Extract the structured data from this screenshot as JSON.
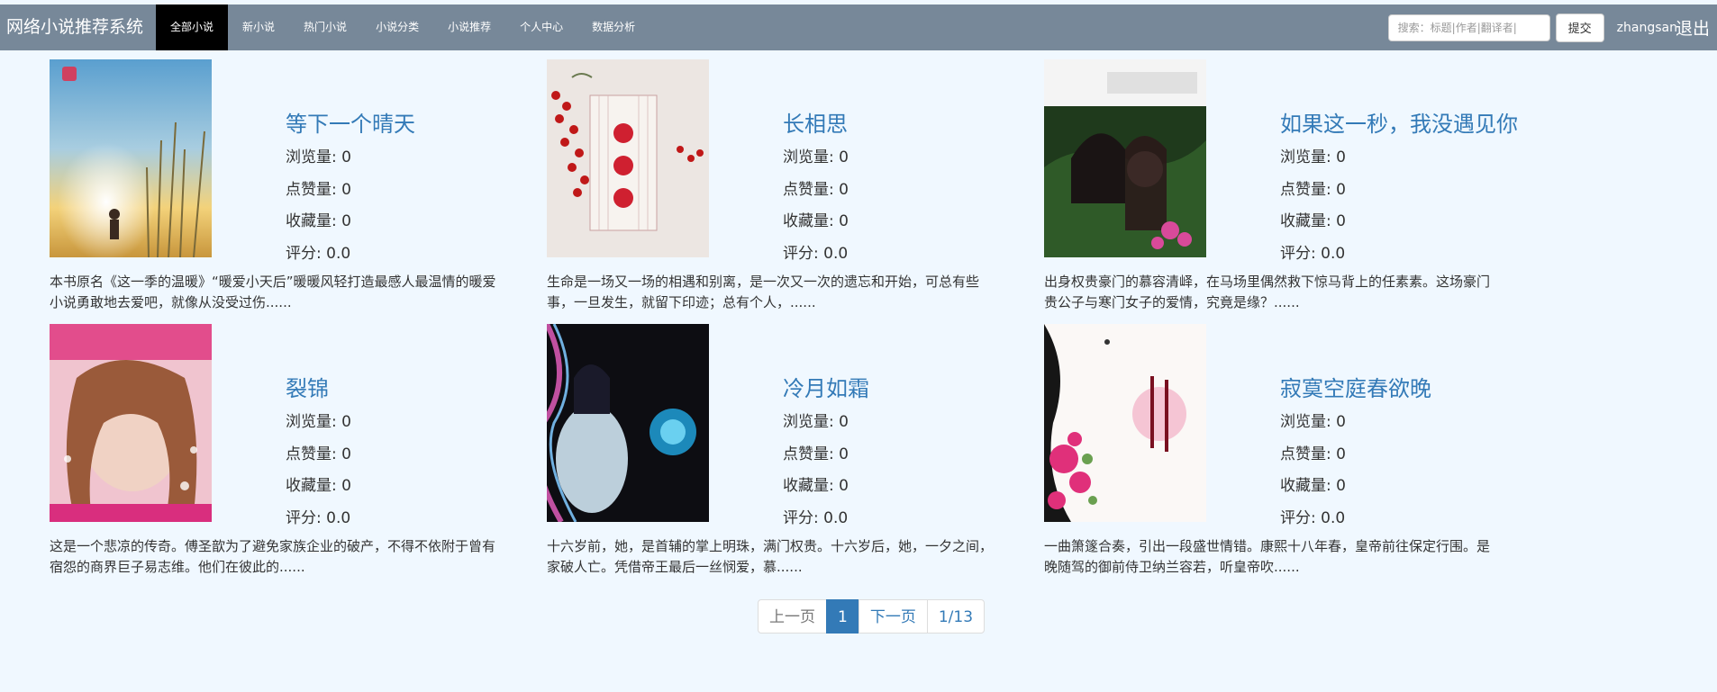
{
  "nav": {
    "brand": "网络小说推荐系统",
    "items": [
      "全部小说",
      "新小说",
      "热门小说",
      "小说分类",
      "小说推荐",
      "个人中心",
      "数据分析"
    ],
    "search_placeholder": "搜索：标题|作者|翻译者|",
    "submit_label": "提交",
    "username": "zhangsan",
    "logout_label": "退出"
  },
  "stat_labels": {
    "views": "浏览量:",
    "likes": "点赞量:",
    "favorites": "收藏量:",
    "rating": "评分:"
  },
  "novels": [
    {
      "title": "等下一个晴天",
      "views": "0",
      "likes": "0",
      "favorites": "0",
      "rating": "0.0",
      "desc": "本书原名《这一季的温暖》“暖爱小天后”暖暖风轻打造最感人最温情的暖爱小说勇敢地去爱吧，就像从没受过伤......",
      "cover_text": "等下一个晴天"
    },
    {
      "title": "长相思",
      "views": "0",
      "likes": "0",
      "favorites": "0",
      "rating": "0.0",
      "desc": "生命是一场又一场的相遇和别离，是一次又一次的遗忘和开始，可总有些事，一旦发生，就留下印迹；总有个人，......",
      "cover_text": "长相思"
    },
    {
      "title": "如果这一秒，我没遇见你",
      "views": "0",
      "likes": "0",
      "favorites": "0",
      "rating": "0.0",
      "desc": "出身权贵豪门的慕容清峄，在马场里偶然救下惊马背上的任素素。这场豪门贵公子与寒门女子的爱情，究竟是缘？......",
      "cover_text": "如果这一秒，我没遇见你"
    },
    {
      "title": "裂锦",
      "views": "0",
      "likes": "0",
      "favorites": "0",
      "rating": "0.0",
      "desc": "这是一个悲凉的传奇。傅圣歆为了避免家族企业的破产，不得不依附于曾有宿怨的商界巨子易志维。他们在彼此的......",
      "cover_text": "裂锦"
    },
    {
      "title": "冷月如霜",
      "views": "0",
      "likes": "0",
      "favorites": "0",
      "rating": "0.0",
      "desc": "十六岁前，她，是首辅的掌上明珠，满门权贵。十六岁后，她，一夕之间，家破人亡。凭借帝王最后一丝悯爱，慕......",
      "cover_text": "冷月如霜"
    },
    {
      "title": "寂寞空庭春欲晚",
      "views": "0",
      "likes": "0",
      "favorites": "0",
      "rating": "0.0",
      "desc": "一曲箫篴合奏，引出一段盛世情错。康熙十八年春，皇帝前往保定行围。是晚随驾的御前侍卫纳兰容若，听皇帝吹......",
      "cover_text": "寂寞空庭春欲晚"
    }
  ],
  "pagination": {
    "prev": "上一页",
    "current": "1",
    "next": "下一页",
    "total": "1/13"
  }
}
